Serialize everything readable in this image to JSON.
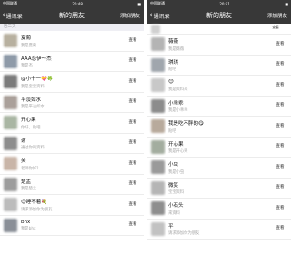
{
  "left": {
    "status": {
      "carrier": "中国联通",
      "time": "20:48",
      "battery": "■"
    },
    "nav": {
      "back": "通讯录",
      "title": "新的朋友",
      "add": "添加朋友"
    },
    "section": "近三天",
    "rows": [
      {
        "name": "夏葡",
        "sub": "我是夏葡",
        "action": "查看",
        "color": "#b7b09f"
      },
      {
        "name": "AAA恋伊～杰",
        "sub": "我是杰",
        "action": "查看",
        "color": "#8e9aa8"
      },
      {
        "name": "@小十一💝🍀",
        "sub": "我是宝宝资料",
        "action": "查看",
        "color": "#7b7b7b"
      },
      {
        "name": "平淡如水",
        "sub": "我是平淡如水",
        "action": "查看",
        "color": "#aaa09a"
      },
      {
        "name": "开心果",
        "sub": "你好，贴吧",
        "action": "查看",
        "color": "#a9b6a3"
      },
      {
        "name": "谢",
        "sub": "通过你的资料",
        "action": "查看",
        "color": "#8d8d8d"
      },
      {
        "name": "美",
        "sub": "老师你好？",
        "action": "查看",
        "color": "#c9b5a8"
      },
      {
        "name": "楚孟",
        "sub": "我是楚孟",
        "action": "查看",
        "color": "#9d9d9d"
      },
      {
        "name": "😊睡不着💐",
        "sub": "请求添加你为朋友",
        "action": "查看",
        "color": "#bcbcbc"
      },
      {
        "name": "bhx",
        "sub": "我是bhx",
        "action": "查看",
        "color": "#8a8f97"
      }
    ]
  },
  "right": {
    "status": {
      "carrier": "中国联通",
      "time": "20:51",
      "battery": "■"
    },
    "nav": {
      "back": "通讯录",
      "title": "新的朋友",
      "add": "添加朋友"
    },
    "top_row": {
      "action": "查看",
      "color": "#d0d0d0"
    },
    "rows": [
      {
        "name": "薇薇",
        "sub": "我是薇薇",
        "action": "查看",
        "color": "#b4b4b4"
      },
      {
        "name": "琪琪",
        "sub": "贴吧",
        "action": "查看",
        "color": "#a0a6ad"
      },
      {
        "name": "😊",
        "sub": "我是资料来",
        "action": "查看",
        "color": "#c8c8c8"
      },
      {
        "name": "小乖乖",
        "sub": "我是小乖乖",
        "action": "查看",
        "color": "#8c8c8c"
      },
      {
        "name": "我是吃不胖的😋",
        "sub": "贴吧",
        "action": "查看",
        "color": "#b8aa9c"
      },
      {
        "name": "开心果",
        "sub": "我是开心果",
        "action": "查看",
        "color": "#a3ad9f"
      },
      {
        "name": "小虫",
        "sub": "我是小虫",
        "action": "查看",
        "color": "#9a9a9a"
      },
      {
        "name": "微笑",
        "sub": "宝宝资料",
        "action": "查看",
        "color": "#b5b5b5"
      },
      {
        "name": "小石头",
        "sub": "来资料",
        "action": "查看",
        "color": "#8e8e8e"
      },
      {
        "name": "平",
        "sub": "请求添加你为朋友",
        "action": "查看",
        "color": "#c2c2c2"
      }
    ]
  }
}
